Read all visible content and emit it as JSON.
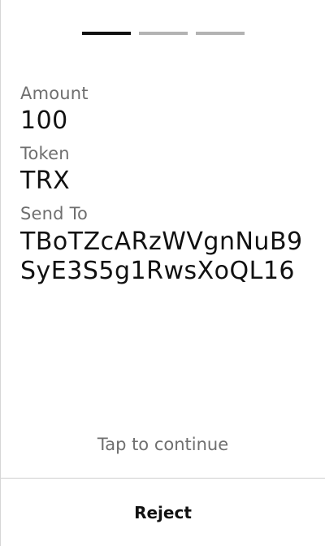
{
  "progress": {
    "total_steps": 3,
    "current_step": 1
  },
  "details": {
    "amount_label": "Amount",
    "amount_value": "100",
    "token_label": "Token",
    "token_value": "TRX",
    "send_to_label": "Send To",
    "send_to_value": "TBoTZcARzWVgnNuB9SyE3S5g1RwsXoQL16"
  },
  "footer": {
    "tap_hint": "Tap to continue",
    "reject_label": "Reject"
  },
  "colors": {
    "text_primary": "#111111",
    "text_secondary": "#6f6f6f",
    "step_active": "#111111",
    "step_inactive": "#b3b3b3"
  }
}
